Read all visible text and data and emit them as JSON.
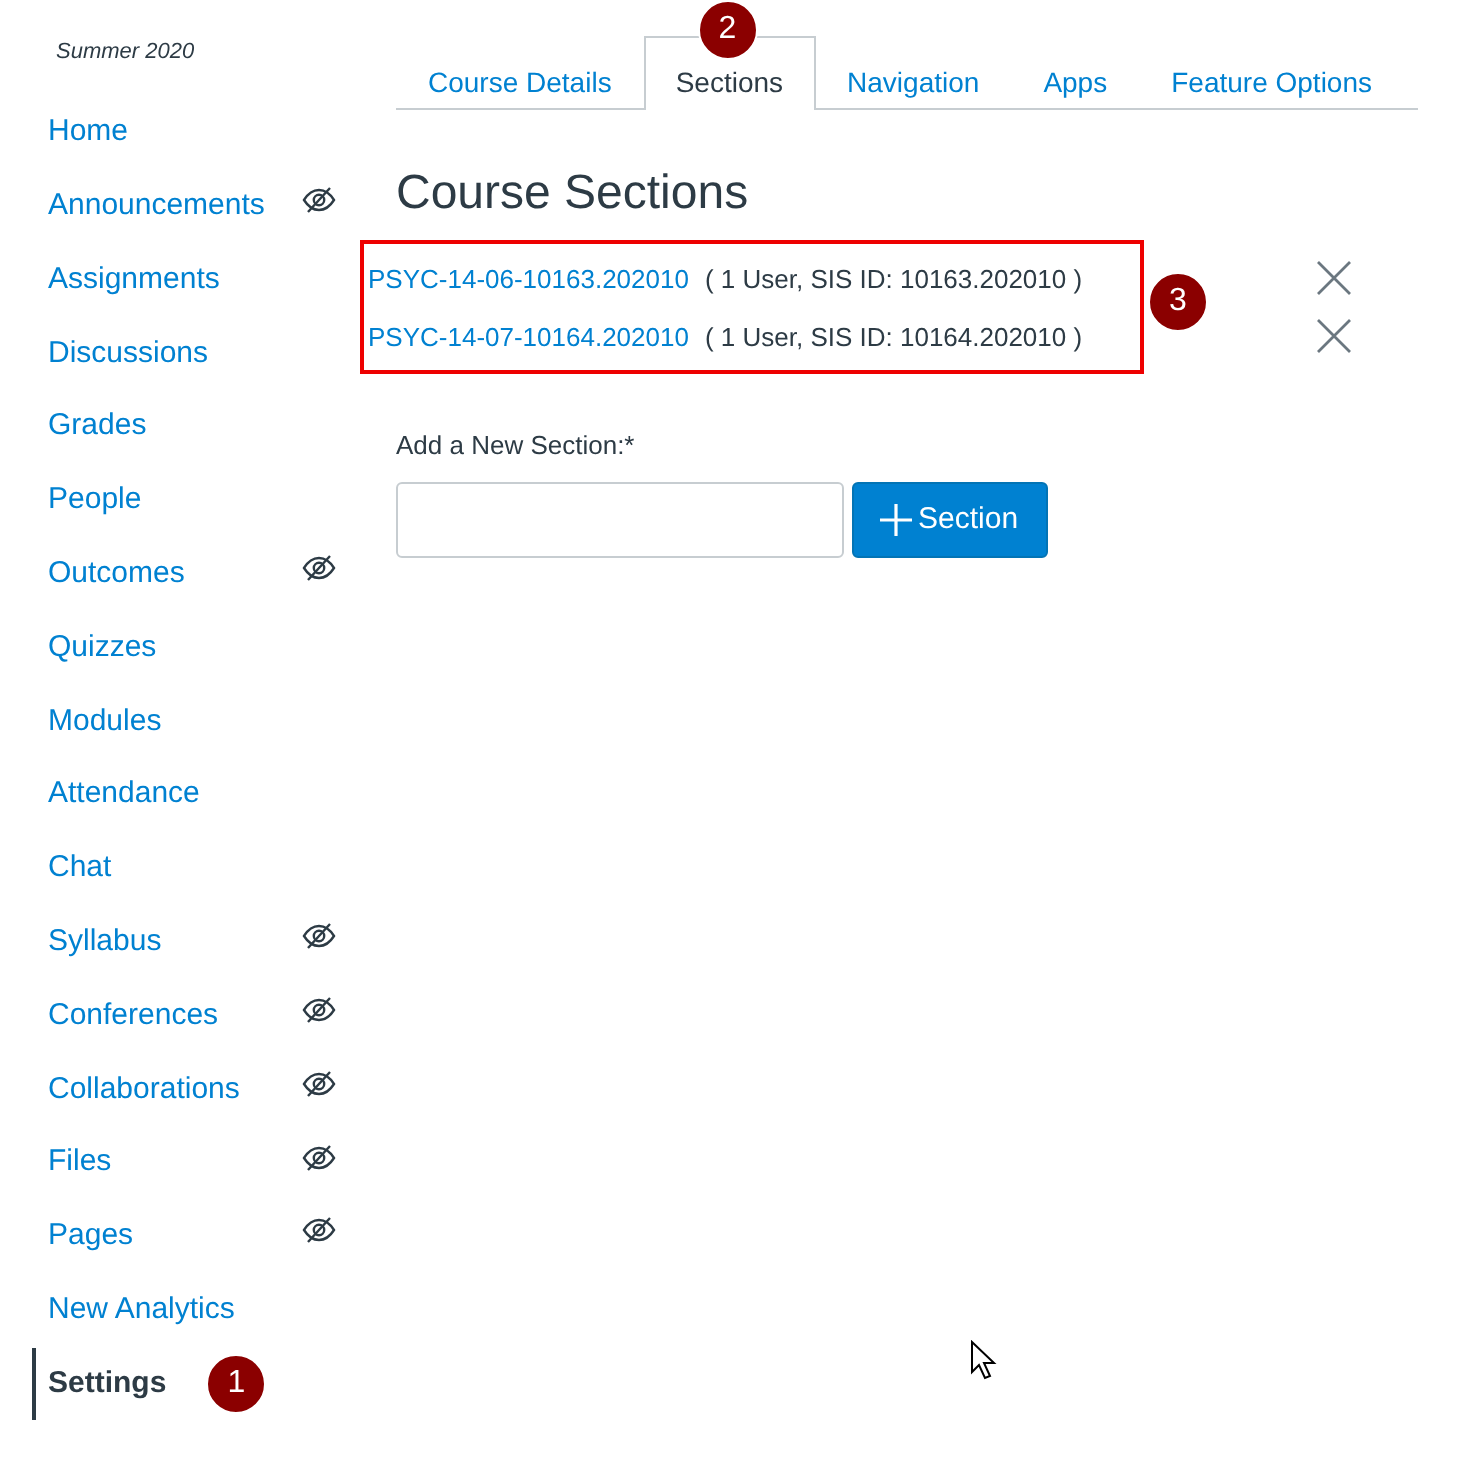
{
  "term": "Summer 2020",
  "sidebar": {
    "items": [
      {
        "label": "Home",
        "hidden": false,
        "selected": false
      },
      {
        "label": "Announcements",
        "hidden": true,
        "selected": false
      },
      {
        "label": "Assignments",
        "hidden": false,
        "selected": false
      },
      {
        "label": "Discussions",
        "hidden": false,
        "selected": false
      },
      {
        "label": "Grades",
        "hidden": false,
        "selected": false
      },
      {
        "label": "People",
        "hidden": false,
        "selected": false
      },
      {
        "label": "Outcomes",
        "hidden": true,
        "selected": false
      },
      {
        "label": "Quizzes",
        "hidden": false,
        "selected": false
      },
      {
        "label": "Modules",
        "hidden": false,
        "selected": false
      },
      {
        "label": "Attendance",
        "hidden": false,
        "selected": false
      },
      {
        "label": "Chat",
        "hidden": false,
        "selected": false
      },
      {
        "label": "Syllabus",
        "hidden": true,
        "selected": false
      },
      {
        "label": "Conferences",
        "hidden": true,
        "selected": false
      },
      {
        "label": "Collaborations",
        "hidden": true,
        "selected": false
      },
      {
        "label": "Files",
        "hidden": true,
        "selected": false
      },
      {
        "label": "Pages",
        "hidden": true,
        "selected": false
      },
      {
        "label": "New Analytics",
        "hidden": false,
        "selected": false
      },
      {
        "label": "Settings",
        "hidden": false,
        "selected": true,
        "callout": "1"
      }
    ]
  },
  "tabs": [
    {
      "label": "Course Details",
      "selected": false
    },
    {
      "label": "Sections",
      "selected": true,
      "callout": "2"
    },
    {
      "label": "Navigation",
      "selected": false
    },
    {
      "label": "Apps",
      "selected": false
    },
    {
      "label": "Feature Options",
      "selected": false
    }
  ],
  "heading": "Course Sections",
  "sections": {
    "callout": "3",
    "items": [
      {
        "name": "PSYC-14-06-10163.202010",
        "info": "( 1 User, SIS ID: 10163.202010 )"
      },
      {
        "name": "PSYC-14-07-10164.202010",
        "info": "( 1 User, SIS ID: 10164.202010 )"
      }
    ]
  },
  "add_section": {
    "label": "Add a New Section:*",
    "button": "Section"
  }
}
